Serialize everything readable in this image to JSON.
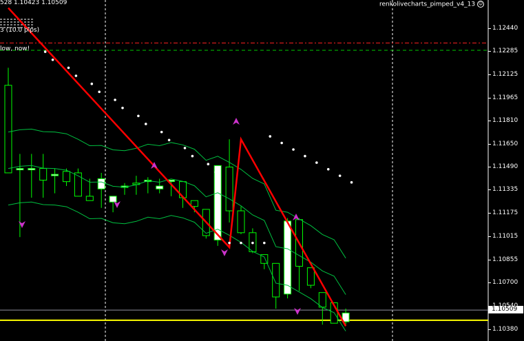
{
  "header": {
    "ohlc": "528 1.10423 1.10509",
    "pips": "3 (10.0 pips)",
    "message": "low, now!",
    "indicator_name": "renkolivecharts_pimped_v4_13",
    "smile_icon": "smile-icon"
  },
  "colors": {
    "background": "#000000",
    "bull_candle": "#ffffff",
    "bear_candle": "#000000",
    "wick": "#00ff00",
    "zigzag": "#ff0000",
    "bands": "#00c040",
    "sar": "#ffffff",
    "arrows": "#cc33cc",
    "bid_line": "#ffff00",
    "red_level": "#ff2020",
    "green_level": "#00cc00"
  },
  "current_price": "1.10509",
  "chart_data": {
    "type": "candlestick",
    "symbol_suffix": "528",
    "last_close": 1.10509,
    "ylim": [
      1.1035,
      1.1254
    ],
    "y_ticks": [
      "1.12440",
      "1.12285",
      "1.12125",
      "1.11965",
      "1.11810",
      "1.11650",
      "1.11490",
      "1.11335",
      "1.11175",
      "1.11015",
      "1.10855",
      "1.10700",
      "1.10540",
      "1.10380"
    ],
    "horizontal_levels": [
      {
        "name": "red-dashdot",
        "value": 1.1234
      },
      {
        "name": "green-dashed",
        "value": 1.1229
      },
      {
        "name": "bid",
        "value": 1.1044
      },
      {
        "name": "ask-gray",
        "value": 1.1051
      }
    ],
    "candles": [
      {
        "o": 1.1205,
        "h": 1.1217,
        "l": 1.1145,
        "c": 1.1145
      },
      {
        "o": 1.1148,
        "h": 1.1158,
        "l": 1.1101,
        "c": 1.1148
      },
      {
        "o": 1.1148,
        "h": 1.1158,
        "l": 1.1128,
        "c": 1.1148
      },
      {
        "o": 1.1148,
        "h": 1.1158,
        "l": 1.1128,
        "c": 1.114
      },
      {
        "o": 1.1144,
        "h": 1.1148,
        "l": 1.1131,
        "c": 1.1144
      },
      {
        "o": 1.1146,
        "h": 1.1148,
        "l": 1.1136,
        "c": 1.1139
      },
      {
        "o": 1.1145,
        "h": 1.1148,
        "l": 1.113,
        "c": 1.1129
      },
      {
        "o": 1.1129,
        "h": 1.1141,
        "l": 1.1128,
        "c": 1.1126
      },
      {
        "o": 1.1134,
        "h": 1.1145,
        "l": 1.1121,
        "c": 1.1141
      },
      {
        "o": 1.1125,
        "h": 1.1128,
        "l": 1.1118,
        "c": 1.1129
      },
      {
        "o": 1.1135,
        "h": 1.1138,
        "l": 1.113,
        "c": 1.1136
      },
      {
        "o": 1.1138,
        "h": 1.1143,
        "l": 1.113,
        "c": 1.1137
      },
      {
        "o": 1.1139,
        "h": 1.1142,
        "l": 1.1131,
        "c": 1.114
      },
      {
        "o": 1.1134,
        "h": 1.1141,
        "l": 1.1131,
        "c": 1.1136
      },
      {
        "o": 1.114,
        "h": 1.114,
        "l": 1.1129,
        "c": 1.114
      },
      {
        "o": 1.1139,
        "h": 1.1139,
        "l": 1.1121,
        "c": 1.1128
      },
      {
        "o": 1.1126,
        "h": 1.1126,
        "l": 1.1118,
        "c": 1.1122
      },
      {
        "o": 1.112,
        "h": 1.112,
        "l": 1.11,
        "c": 1.1102
      },
      {
        "o": 1.1099,
        "h": 1.115,
        "l": 1.1095,
        "c": 1.115
      },
      {
        "o": 1.1149,
        "h": 1.1168,
        "l": 1.1111,
        "c": 1.1119
      },
      {
        "o": 1.1119,
        "h": 1.1122,
        "l": 1.1103,
        "c": 1.1104
      },
      {
        "o": 1.1104,
        "h": 1.1107,
        "l": 1.109,
        "c": 1.1091
      },
      {
        "o": 1.1089,
        "h": 1.1089,
        "l": 1.1079,
        "c": 1.1083
      },
      {
        "o": 1.1083,
        "h": 1.1083,
        "l": 1.1052,
        "c": 1.106
      },
      {
        "o": 1.1062,
        "h": 1.1114,
        "l": 1.1059,
        "c": 1.1112
      },
      {
        "o": 1.1113,
        "h": 1.1114,
        "l": 1.1064,
        "c": 1.1081
      },
      {
        "o": 1.108,
        "h": 1.108,
        "l": 1.1066,
        "c": 1.1068
      },
      {
        "o": 1.1063,
        "h": 1.1063,
        "l": 1.1041,
        "c": 1.1053
      },
      {
        "o": 1.1056,
        "h": 1.1056,
        "l": 1.1043,
        "c": 1.1042
      },
      {
        "o": 1.1043,
        "h": 1.1052,
        "l": 1.1041,
        "c": 1.1049
      }
    ]
  }
}
